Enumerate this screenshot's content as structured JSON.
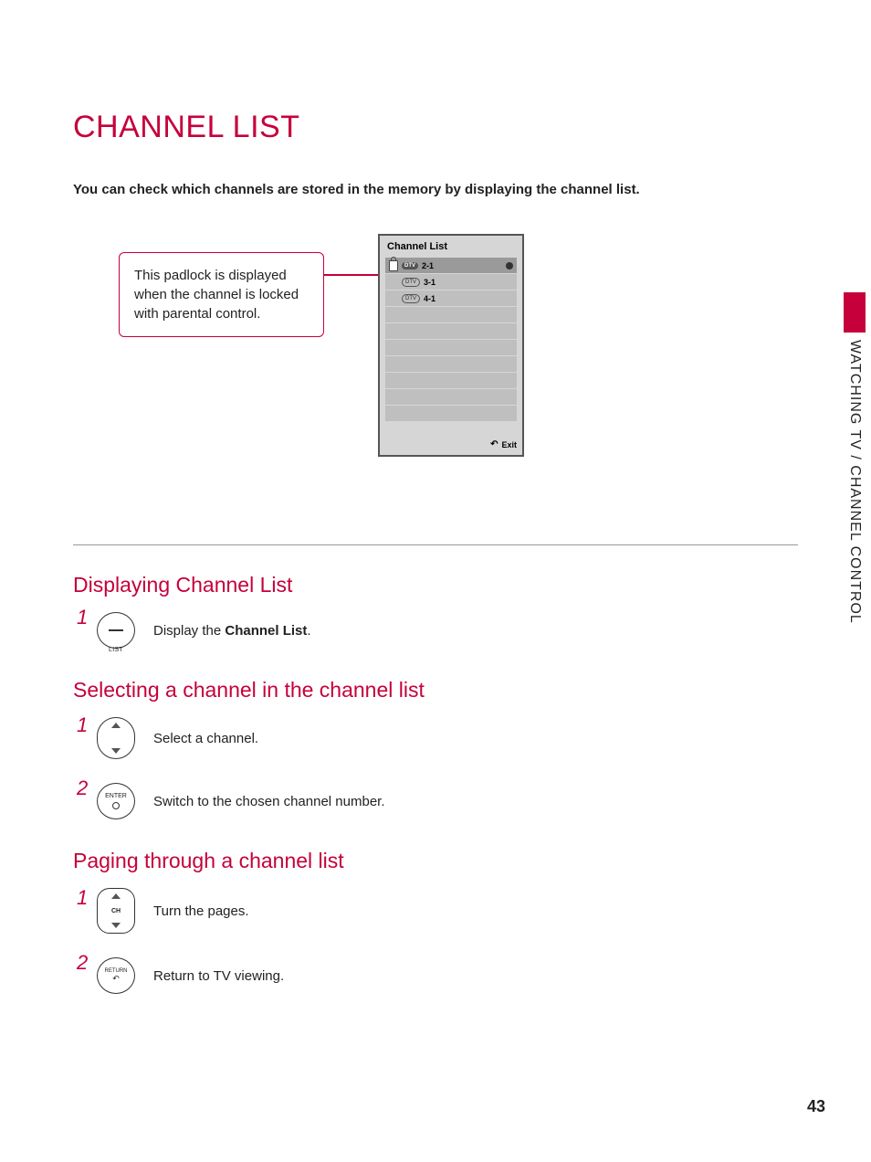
{
  "title": "CHANNEL LIST",
  "intro": "You can check which channels are stored in the memory by displaying the channel list.",
  "callout_text": "This padlock is displayed when the channel is locked with parental control.",
  "osd": {
    "title": "Channel List",
    "rows": [
      {
        "locked": true,
        "type": "dtv",
        "num": "2-1",
        "selected": true
      },
      {
        "locked": false,
        "type": "dtv",
        "num": "3-1",
        "selected": false
      },
      {
        "locked": false,
        "type": "dtv",
        "num": "4-1",
        "selected": false
      }
    ],
    "exit_label": "Exit"
  },
  "sections": {
    "display": {
      "heading": "Displaying Channel List",
      "steps": [
        {
          "n": "1",
          "btn": "list",
          "btn_inner": "—",
          "btn_label": "LIST",
          "text_pre": "Display the ",
          "text_bold": "Channel List",
          "text_post": "."
        }
      ]
    },
    "select": {
      "heading": "Selecting a channel in the channel list",
      "steps": [
        {
          "n": "1",
          "btn": "updown",
          "text": "Select a channel."
        },
        {
          "n": "2",
          "btn": "enter",
          "btn_inner": "ENTER",
          "text": "Switch to the chosen channel number."
        }
      ]
    },
    "paging": {
      "heading": "Paging through a channel list",
      "steps": [
        {
          "n": "1",
          "btn": "ch",
          "btn_inner": "CH",
          "text": "Turn the pages."
        },
        {
          "n": "2",
          "btn": "return",
          "btn_inner": "RETURN",
          "text": "Return to TV viewing."
        }
      ]
    }
  },
  "side_label": "WATCHING TV / CHANNEL CONTROL",
  "page_number": "43",
  "dtv_label": "DTV"
}
